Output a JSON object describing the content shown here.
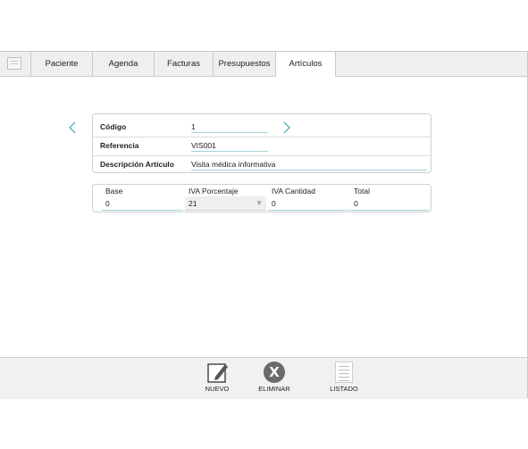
{
  "tabs": [
    {
      "label": "Paciente"
    },
    {
      "label": "Agenda"
    },
    {
      "label": "Facturas"
    },
    {
      "label": "Presupuestos"
    },
    {
      "label": "Artículos",
      "active": true
    }
  ],
  "form": {
    "codigo_label": "Código",
    "codigo_value": "1",
    "referencia_label": "Referencia",
    "referencia_value": "VIS001",
    "descripcion_label": "Descripción Artículo",
    "descripcion_value": "Visita médica informativa"
  },
  "iva": {
    "headers": [
      "Base",
      "IVA Porcentaje",
      "IVA Cantidad",
      "Total"
    ],
    "values": [
      "0",
      "21",
      "0",
      "0"
    ]
  },
  "toolbar": {
    "nuevo_label": "NUEVO",
    "eliminar_label": "ELIMINAR",
    "listado_label": "LISTADO"
  },
  "icons": {
    "prev": "chevron-left-icon",
    "next": "chevron-right-icon",
    "nuevo": "edit-icon",
    "eliminar": "delete-icon",
    "listado": "list-icon"
  },
  "colors": {
    "accent": "#4fb0ba",
    "tabbar": "#efefef",
    "footer": "#f1f1f1"
  }
}
